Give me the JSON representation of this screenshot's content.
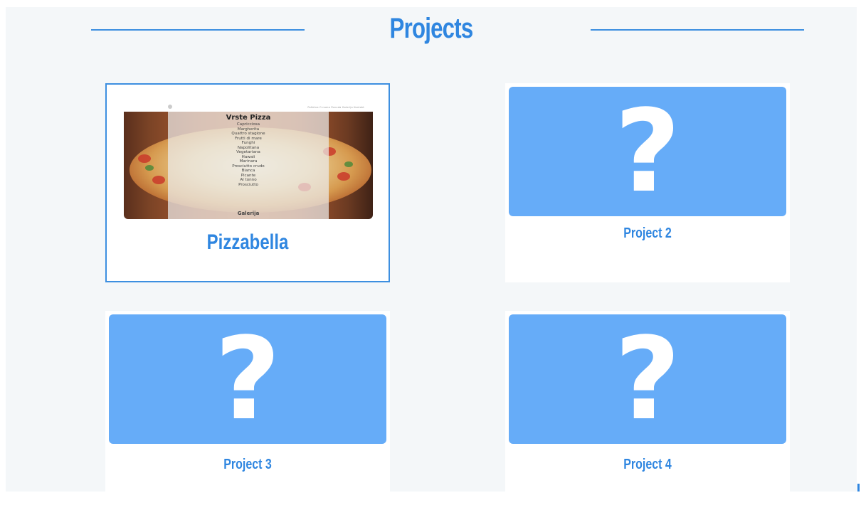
{
  "header": {
    "title": "Projects"
  },
  "projects": [
    {
      "label": "Pizzabella",
      "screenshot": {
        "nav": "Početna  O nama  Ponuda  Galerija  Kontakt",
        "menu_title": "Vrste Pizza",
        "menu_items": [
          "Capricciosa",
          "Margherita",
          "Quattro stagione",
          "Frutti di mare",
          "Funghi",
          "Napolitana",
          "Vegetariana",
          "Hawaii",
          "Marinara",
          "Prosciutto crudo",
          "Bianca",
          "Picante",
          "Al tonno",
          "Prosciutto"
        ],
        "footer_text": "Galerija"
      }
    },
    {
      "label": "Project 2",
      "icon": "question-mark-icon"
    },
    {
      "label": "Project 3",
      "icon": "question-mark-icon"
    },
    {
      "label": "Project 4",
      "icon": "question-mark-icon"
    }
  ],
  "colors": {
    "accent": "#2f86e0",
    "placeholder": "#66acf8",
    "background": "#f4f7f9"
  }
}
